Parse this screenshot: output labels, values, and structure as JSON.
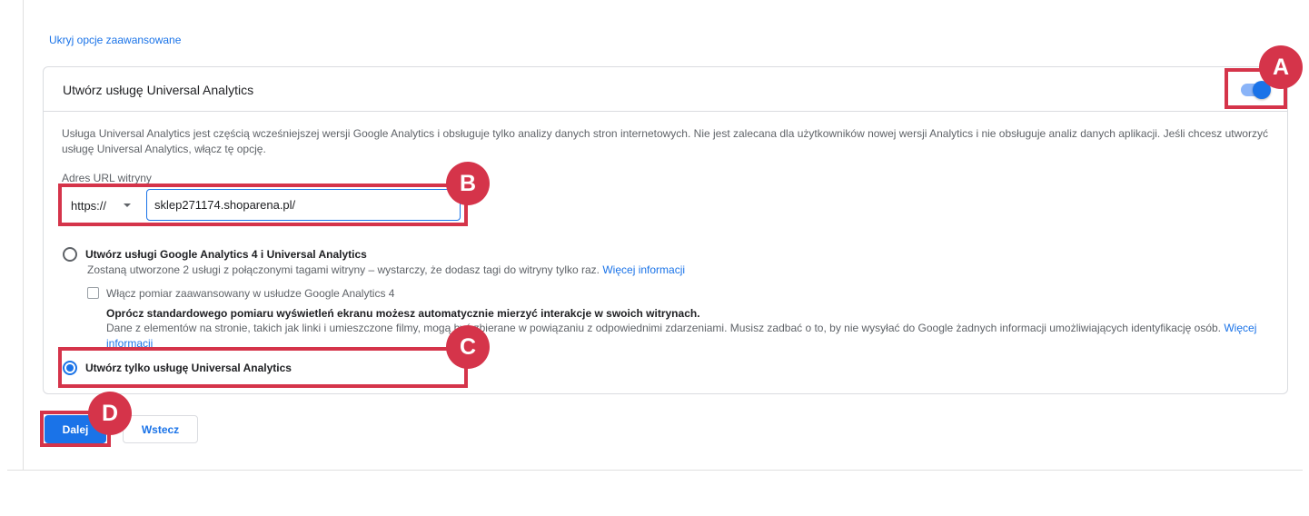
{
  "advanced_link": "Ukryj opcje zaawansowane",
  "ua_card": {
    "title": "Utwórz usługę Universal Analytics",
    "toggle_on": true,
    "description": "Usługa Universal Analytics jest częścią wcześniejszej wersji Google Analytics i obsługuje tylko analizy danych stron internetowych. Nie jest zalecana dla użytkowników nowej wersji Analytics i nie obsługuje analiz danych aplikacji. Jeśli chcesz utworzyć usługę Universal Analytics, włącz tę opcję.",
    "url_label": "Adres URL witryny",
    "protocol": "https://",
    "url_value": "sklep271174.shoparena.pl/"
  },
  "options": {
    "both": {
      "title": "Utwórz usługi Google Analytics 4 i Universal Analytics",
      "subtitle": "Zostaną utworzone 2 usługi z połączonymi tagami witryny – wystarczy, że dodasz tagi do witryny tylko raz.",
      "link": "Więcej informacji",
      "checkbox_label": "Włącz pomiar zaawansowany w usłudze Google Analytics 4",
      "enhanced_title": "Oprócz standardowego pomiaru wyświetleń ekranu możesz automatycznie mierzyć interakcje w swoich witrynach.",
      "enhanced_desc": "Dane z elementów na stronie, takich jak linki i umieszczone filmy, mogą być zbierane w powiązaniu z odpowiednimi zdarzeniami. Musisz zadbać o to, by nie wysyłać do Google żadnych informacji umożliwiających identyfikację osób.",
      "enhanced_link": "Więcej informacji"
    },
    "ua_only": {
      "title": "Utwórz tylko usługę Universal Analytics",
      "selected": true
    }
  },
  "buttons": {
    "next": "Dalej",
    "back": "Wstecz"
  },
  "callouts": {
    "a": "A",
    "b": "B",
    "c": "C",
    "d": "D",
    "color": "#d5344a"
  },
  "colors": {
    "accent": "#1a73e8",
    "text": "#202124",
    "muted": "#5f6368"
  }
}
